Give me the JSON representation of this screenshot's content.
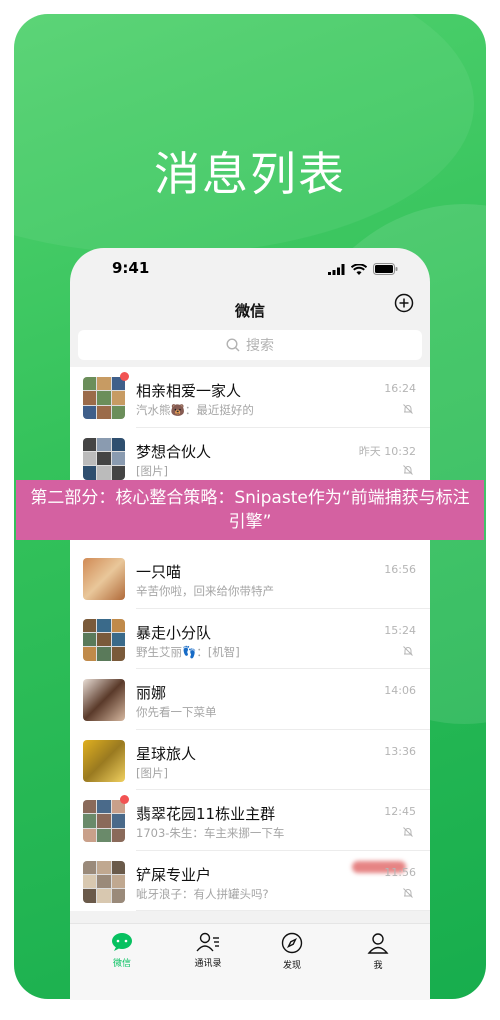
{
  "headline": "消息列表",
  "status_bar": {
    "time": "9:41"
  },
  "nav": {
    "title": "微信"
  },
  "search": {
    "placeholder": "搜索"
  },
  "chats": [
    {
      "name": "相亲相爱一家人",
      "preview": "汽水熊🐻：最近挺好的",
      "time": "16:24",
      "muted": true,
      "unread_dot": true,
      "avatar_colors": [
        "#6b8e5a",
        "#c79b63",
        "#3f5f8a",
        "#9b6b4a"
      ]
    },
    {
      "name": "梦想合伙人",
      "preview": "[图片]",
      "time": "昨天 10:32",
      "muted": true,
      "unread_dot": false,
      "avatar_colors": [
        "#444",
        "#8a9bb0",
        "#2f4f6f",
        "#bbb"
      ]
    },
    {
      "name": "一只喵",
      "preview": "辛苦你啦，回来给你带特产",
      "time": "16:56",
      "muted": false,
      "unread_dot": false,
      "avatar_colors": [
        "#d08a55",
        "#e9c79a",
        "#b06a3a",
        "#f0dcc0"
      ]
    },
    {
      "name": "暴走小分队",
      "preview": "野生艾丽👣：[机智]",
      "time": "15:24",
      "muted": true,
      "unread_dot": false,
      "avatar_colors": [
        "#7a5a3a",
        "#3a6a8a",
        "#c08a4a",
        "#5a7a5a"
      ]
    },
    {
      "name": "丽娜",
      "preview": "你先看一下菜单",
      "time": "14:06",
      "muted": false,
      "unread_dot": false,
      "avatar_colors": [
        "#e8ddd5",
        "#5a3a2a",
        "#d6b8a0",
        "#f2ebe5"
      ]
    },
    {
      "name": "星球旅人",
      "preview": "[图片]",
      "time": "13:36",
      "muted": false,
      "unread_dot": false,
      "avatar_colors": [
        "#e0b020",
        "#9a7a20",
        "#f0d060",
        "#5a4a20"
      ]
    },
    {
      "name": "翡翠花园11栋业主群",
      "preview": "1703-朱生：车主来挪一下车",
      "time": "12:45",
      "muted": true,
      "unread_dot": true,
      "avatar_colors": [
        "#8a6a5a",
        "#4a6a8a",
        "#c9a08a",
        "#6a8a6a"
      ]
    },
    {
      "name": "铲屎专业户",
      "preview": "呲牙浪子：有人拼罐头吗?",
      "time": "11:56",
      "muted": true,
      "unread_dot": false,
      "avatar_colors": [
        "#9a8a7a",
        "#c0a890",
        "#6a5a4a",
        "#d8c8b0"
      ]
    }
  ],
  "tabs": [
    {
      "label": "微信",
      "icon": "chat-bubble-icon",
      "active": true
    },
    {
      "label": "通讯录",
      "icon": "contacts-icon",
      "active": false
    },
    {
      "label": "发现",
      "icon": "compass-icon",
      "active": false
    },
    {
      "label": "我",
      "icon": "person-icon",
      "active": false
    }
  ],
  "overlay_banner": "第二部分：核心整合策略：Snipaste作为“前端捕获与标注引擎”",
  "colors": {
    "brand_green": "#07c160",
    "background_green": "#34c25b",
    "overlay_pink": "#d461a1",
    "unread_red": "#f25353"
  }
}
